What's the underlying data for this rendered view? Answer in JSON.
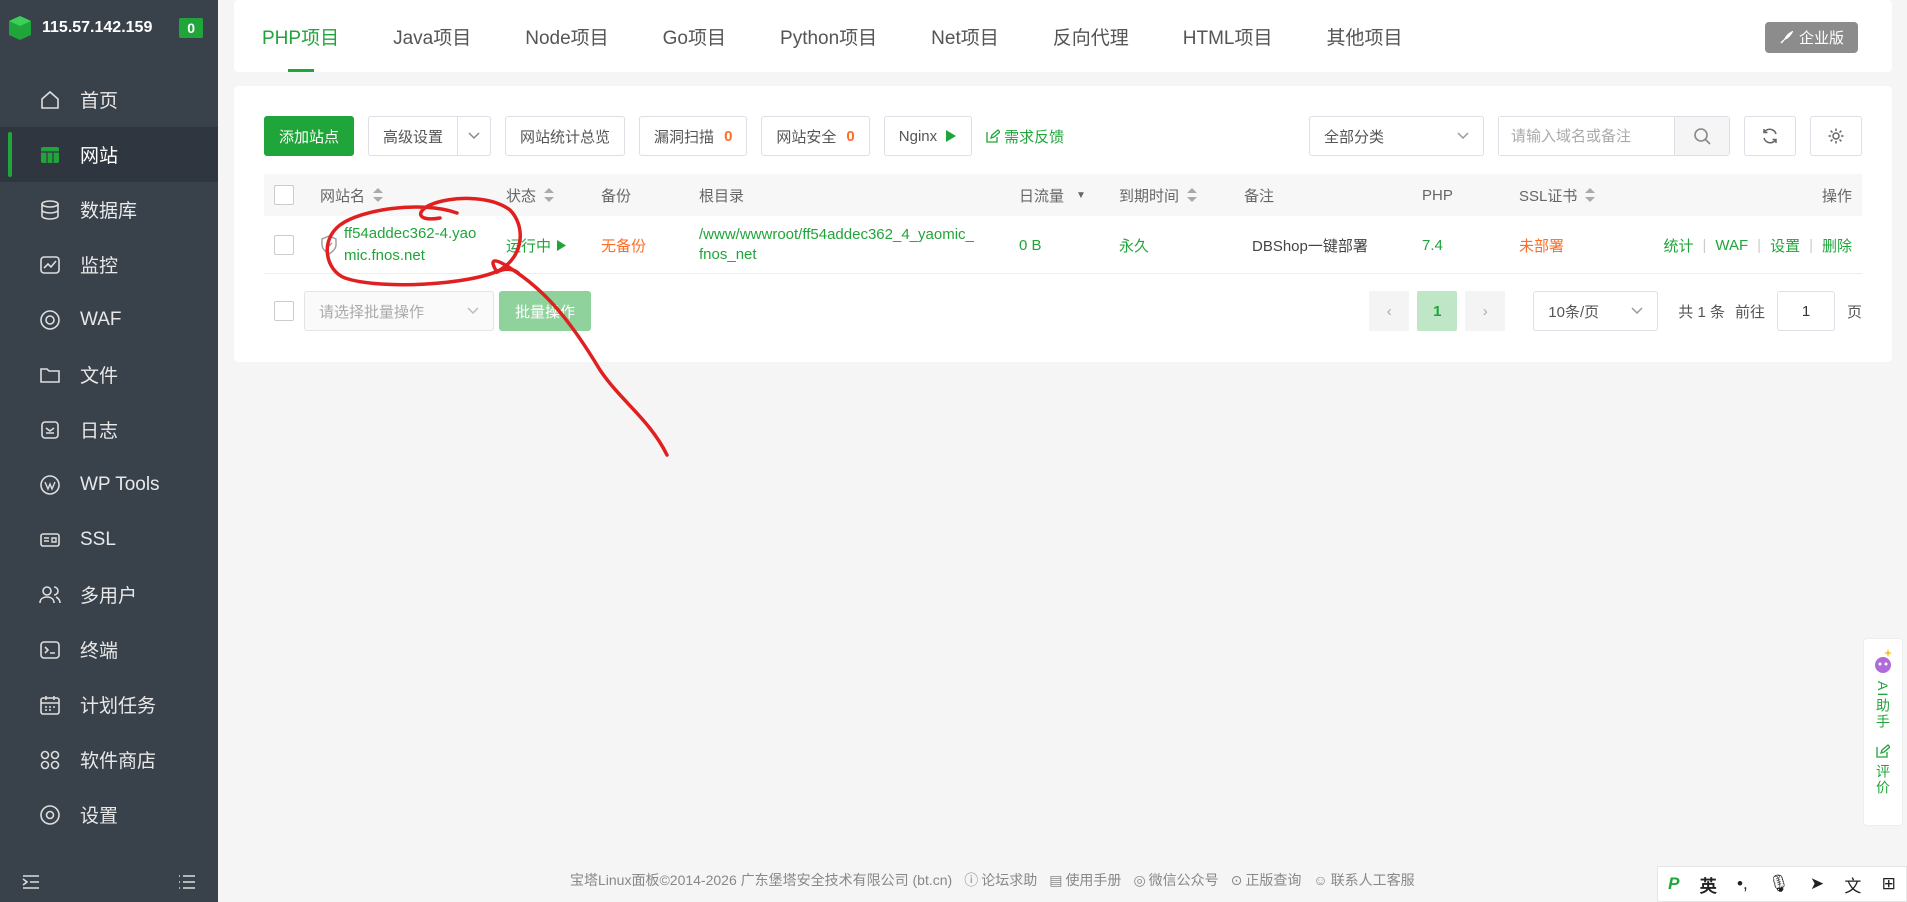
{
  "sidebar": {
    "ip": "115.57.142.159",
    "badge": "0",
    "items": [
      {
        "label": "首页",
        "icon": "home-icon"
      },
      {
        "label": "网站",
        "icon": "website-icon"
      },
      {
        "label": "数据库",
        "icon": "database-icon"
      },
      {
        "label": "监控",
        "icon": "monitor-icon"
      },
      {
        "label": "WAF",
        "icon": "waf-icon"
      },
      {
        "label": "文件",
        "icon": "folder-icon"
      },
      {
        "label": "日志",
        "icon": "log-icon"
      },
      {
        "label": "WP Tools",
        "icon": "wordpress-icon"
      },
      {
        "label": "SSL",
        "icon": "ssl-icon"
      },
      {
        "label": "多用户",
        "icon": "users-icon"
      },
      {
        "label": "终端",
        "icon": "terminal-icon"
      },
      {
        "label": "计划任务",
        "icon": "calendar-icon"
      },
      {
        "label": "软件商店",
        "icon": "app-store-icon"
      },
      {
        "label": "设置",
        "icon": "settings-icon"
      }
    ],
    "active_index": 1
  },
  "tabs": [
    "PHP项目",
    "Java项目",
    "Node项目",
    "Go项目",
    "Python项目",
    "Net项目",
    "反向代理",
    "HTML项目",
    "其他项目"
  ],
  "enterprise_label": "企业版",
  "toolbar": {
    "add_site": "添加站点",
    "advanced": "高级设置",
    "stats_overview": "网站统计总览",
    "vuln_scan": "漏洞扫描",
    "vuln_count": "0",
    "site_security": "网站安全",
    "security_count": "0",
    "nginx": "Nginx",
    "feedback": "需求反馈",
    "category": "全部分类",
    "search_placeholder": "请输入域名或备注"
  },
  "table": {
    "headers": {
      "name": "网站名",
      "status": "状态",
      "backup": "备份",
      "root": "根目录",
      "traffic": "日流量",
      "expire": "到期时间",
      "remark": "备注",
      "php": "PHP",
      "ssl": "SSL证书",
      "ops": "操作"
    },
    "rows": [
      {
        "name_line1": "ff54addec362-4.yao",
        "name_line2": "mic.fnos.net",
        "status": "运行中",
        "backup": "无备份",
        "root_line1": "/www/wwwroot/ff54addec362_4_yaomic_",
        "root_line2": "fnos_net",
        "traffic": "0 B",
        "expire": "永久",
        "remark": "DBShop一键部署",
        "php": "7.4",
        "ssl": "未部署",
        "ops": [
          "统计",
          "WAF",
          "设置",
          "删除"
        ]
      }
    ]
  },
  "batch": {
    "placeholder": "请选择批量操作",
    "button": "批量操作"
  },
  "pager": {
    "current": "1",
    "page_size": "10条/页",
    "total": "共 1 条",
    "goto_label": "前往",
    "goto_value": "1",
    "page_suffix": "页"
  },
  "footer": {
    "copyright": "宝塔Linux面板©2014-2026 广东堡塔安全技术有限公司 (bt.cn)",
    "links": [
      "论坛求助",
      "使用手册",
      "微信公众号",
      "正版查询",
      "联系人工客服"
    ]
  },
  "ai_side": {
    "assistant": "AI助手",
    "review": "评价"
  },
  "ime": {
    "mode": "英"
  },
  "colors": {
    "accent": "#20a53a",
    "warning": "#fc6d26",
    "sidebar": "#39414b",
    "annotation": "#e02020"
  }
}
